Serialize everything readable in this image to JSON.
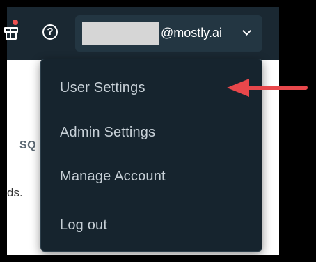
{
  "content": {
    "tab_partial": "SQ",
    "text_partial": "ds."
  },
  "header": {
    "account": {
      "email_suffix": "@mostly.ai"
    }
  },
  "menu": {
    "items": [
      {
        "label": "User Settings"
      },
      {
        "label": "Admin Settings"
      },
      {
        "label": "Manage Account"
      },
      {
        "label": "Log out"
      }
    ]
  },
  "colors": {
    "header_bg": "#1a2832",
    "menu_bg": "#16242e",
    "annotation_arrow": "#e8474b",
    "notification_dot": "#f05252"
  },
  "icons": [
    "gift-icon",
    "help-icon",
    "chevron-down-icon",
    "arrow-left-icon"
  ]
}
